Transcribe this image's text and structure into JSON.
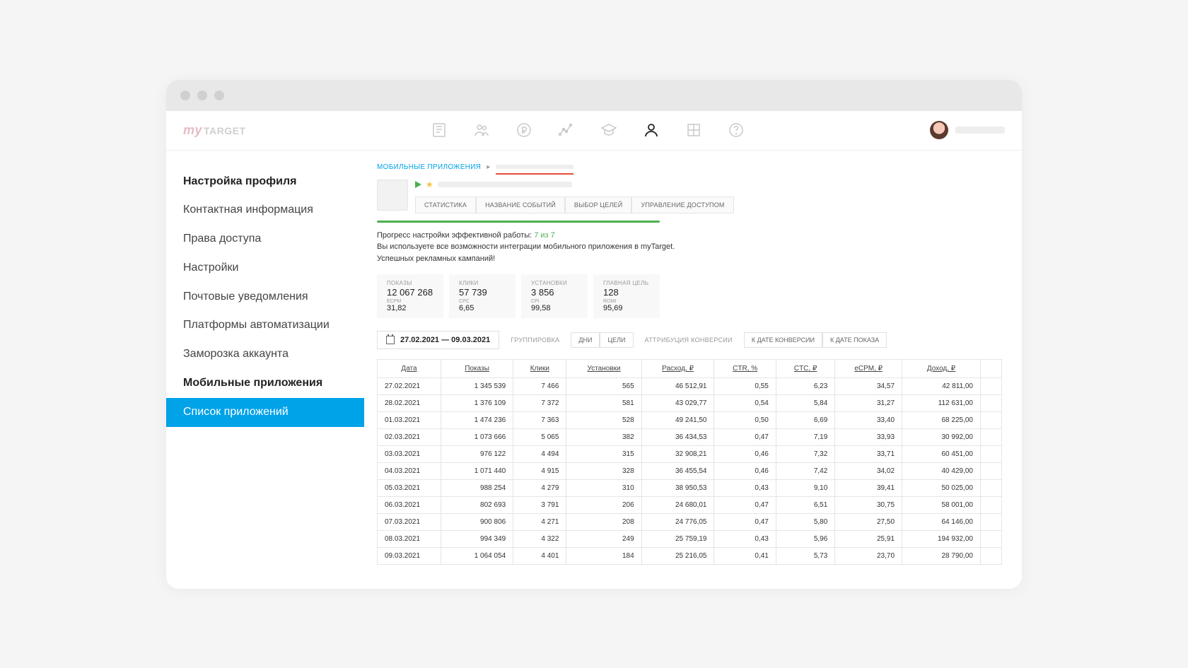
{
  "logo": {
    "part1": "my",
    "part2": "TARGET"
  },
  "sidebar": {
    "items": [
      {
        "label": "Настройка профиля",
        "bold": true
      },
      {
        "label": "Контактная информация"
      },
      {
        "label": "Права доступа"
      },
      {
        "label": "Настройки"
      },
      {
        "label": "Почтовые уведомления"
      },
      {
        "label": "Платформы автоматизации"
      },
      {
        "label": "Заморозка аккаунта"
      },
      {
        "label": "Мобильные приложения",
        "bold": true
      },
      {
        "label": "Список приложений",
        "active": true
      }
    ]
  },
  "breadcrumb": {
    "root": "МОБИЛЬНЫЕ ПРИЛОЖЕНИЯ"
  },
  "tabs": [
    "СТАТИСТИКА",
    "НАЗВАНИЕ СОБЫТИЙ",
    "ВЫБОР ЦЕЛЕЙ",
    "УПРАВЛЕНИЕ ДОСТУПОМ"
  ],
  "progress": {
    "line1_prefix": "Прогресс настройки эффективной работы: ",
    "line1_value": "7 из 7",
    "line2": "Вы используете все возможности интеграции мобильного приложения в myTarget.",
    "line3": "Успешных рекламных кампаний!"
  },
  "stats": [
    {
      "label": "ПОКАЗЫ",
      "value": "12 067 268",
      "label2": "ECPM",
      "value2": "31,82"
    },
    {
      "label": "КЛИКИ",
      "value": "57 739",
      "label2": "CPC",
      "value2": "6,65"
    },
    {
      "label": "УСТАНОВКИ",
      "value": "3 856",
      "label2": "CPI",
      "value2": "99,58"
    },
    {
      "label": "ГЛАВНАЯ ЦЕЛЬ",
      "value": "128",
      "label2": "ROMI",
      "value2": "95,69"
    }
  ],
  "toolbar": {
    "date_range": "27.02.2021 — 09.03.2021",
    "group_label": "ГРУППИРОВКА",
    "group_options": [
      "ДНИ",
      "ЦЕЛИ"
    ],
    "attr_label": "АТТРИБУЦИЯ КОНВЕРСИИ",
    "attr_options": [
      "К ДАТЕ КОНВЕРСИИ",
      "К ДАТЕ ПОКАЗА"
    ]
  },
  "table": {
    "headers": [
      "Дата",
      "Показы",
      "Клики",
      "Установки",
      "Расход, ₽",
      "CTR, %",
      "CTC, ₽",
      "eCPM, ₽",
      "Доход, ₽"
    ],
    "rows": [
      [
        "27.02.2021",
        "1 345 539",
        "7 466",
        "565",
        "46 512,91",
        "0,55",
        "6,23",
        "34,57",
        "42 811,00"
      ],
      [
        "28.02.2021",
        "1 376 109",
        "7 372",
        "581",
        "43 029,77",
        "0,54",
        "5,84",
        "31,27",
        "112 631,00"
      ],
      [
        "01.03.2021",
        "1 474 236",
        "7 363",
        "528",
        "49 241,50",
        "0,50",
        "6,69",
        "33,40",
        "68 225,00"
      ],
      [
        "02.03.2021",
        "1 073 666",
        "5 065",
        "382",
        "36 434,53",
        "0,47",
        "7,19",
        "33,93",
        "30 992,00"
      ],
      [
        "03.03.2021",
        "976 122",
        "4 494",
        "315",
        "32 908,21",
        "0,46",
        "7,32",
        "33,71",
        "60 451,00"
      ],
      [
        "04.03.2021",
        "1 071 440",
        "4 915",
        "328",
        "36 455,54",
        "0,46",
        "7,42",
        "34,02",
        "40 429,00"
      ],
      [
        "05.03.2021",
        "988 254",
        "4 279",
        "310",
        "38 950,53",
        "0,43",
        "9,10",
        "39,41",
        "50 025,00"
      ],
      [
        "06.03.2021",
        "802 693",
        "3 791",
        "206",
        "24 680,01",
        "0,47",
        "6,51",
        "30,75",
        "58 001,00"
      ],
      [
        "07.03.2021",
        "900 806",
        "4 271",
        "208",
        "24 776,05",
        "0,47",
        "5,80",
        "27,50",
        "64 146,00"
      ],
      [
        "08.03.2021",
        "994 349",
        "4 322",
        "249",
        "25 759,19",
        "0,43",
        "5,96",
        "25,91",
        "194 932,00"
      ],
      [
        "09.03.2021",
        "1 064 054",
        "4 401",
        "184",
        "25 216,05",
        "0,41",
        "5,73",
        "23,70",
        "28 790,00"
      ]
    ]
  }
}
